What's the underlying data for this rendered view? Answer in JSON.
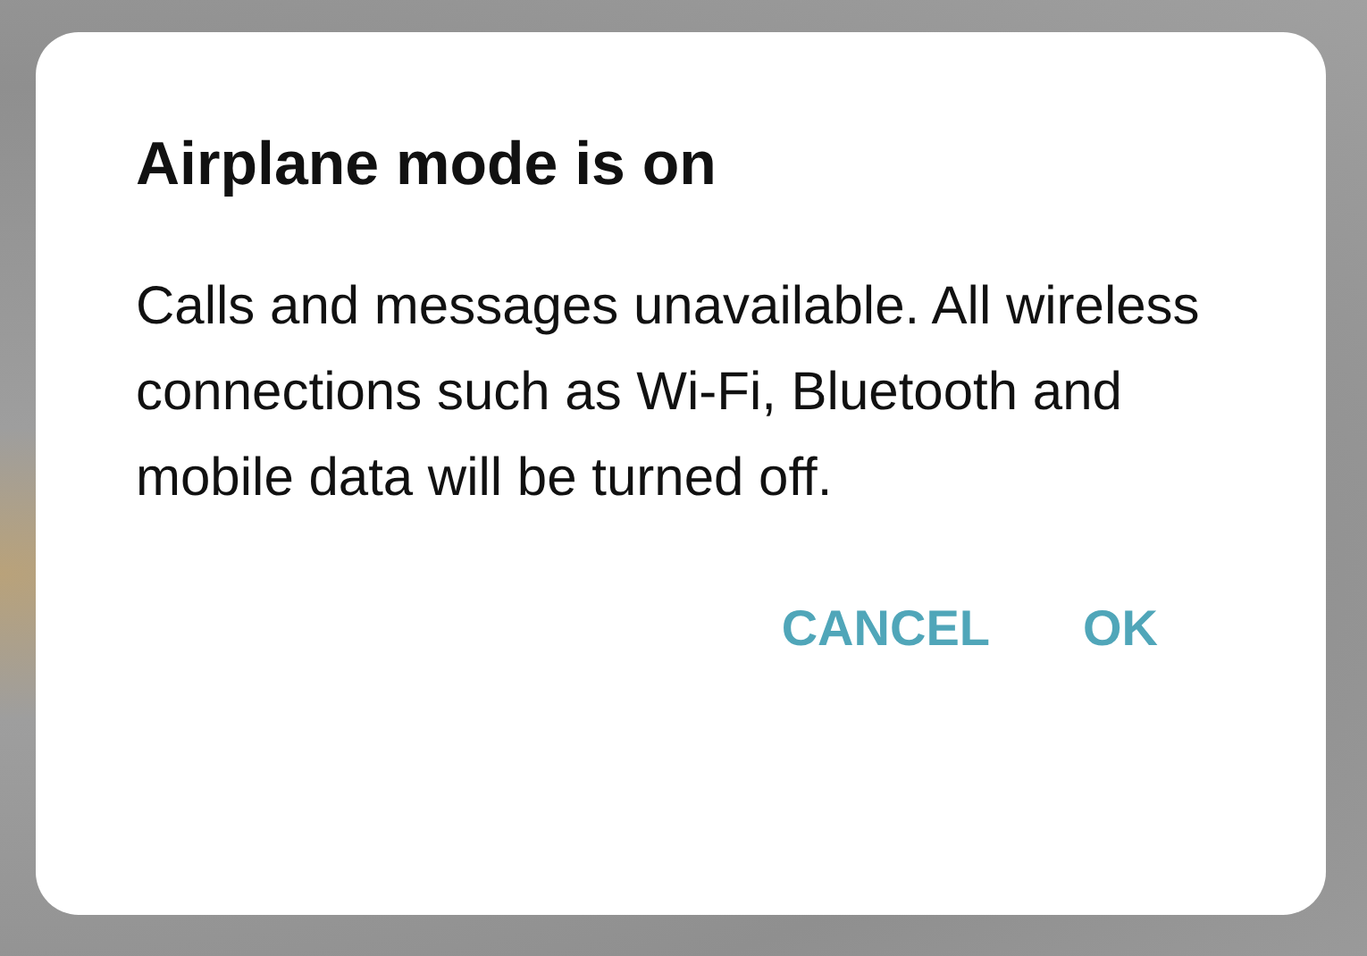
{
  "dialog": {
    "title": "Airplane mode is on",
    "message": "Calls and messages unavailable. All wireless connections such as Wi-Fi, Bluetooth and mobile data will be turned off.",
    "buttons": [
      "CANCEL",
      "OK"
    ]
  }
}
